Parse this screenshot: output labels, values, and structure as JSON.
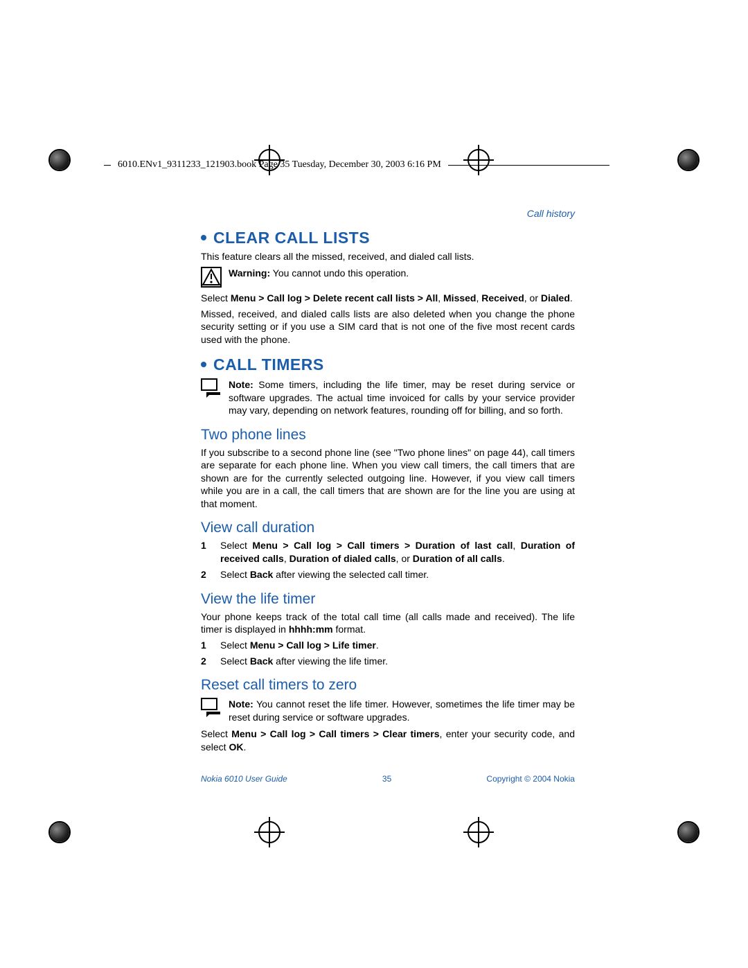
{
  "header": {
    "book_line": "6010.ENv1_9311233_121903.book  Page 35  Tuesday, December 30, 2003  6:16 PM"
  },
  "section_header": "Call history",
  "s1": {
    "title": "CLEAR CALL LISTS",
    "intro": "This feature clears all the missed, received, and dialed call lists.",
    "warning_label": "Warning:",
    "warning_text": " You cannot undo this operation.",
    "select_pre": "Select ",
    "select_bold": "Menu > Call log > Delete recent call lists > All",
    "select_mid1": ", ",
    "select_b2": "Missed",
    "select_mid2": ", ",
    "select_b3": "Received",
    "select_mid3": ", or ",
    "select_b4": "Dialed",
    "select_end": ".",
    "tail": "Missed, received, and dialed calls lists are also deleted when you change the phone security setting or if you use a SIM card that is not one of the five most recent cards used with the phone."
  },
  "s2": {
    "title": "CALL TIMERS",
    "note_label": "Note:",
    "note_text": "  Some timers, including the life timer, may be reset during service or software upgrades. The actual time invoiced for calls by your service provider may vary, depending on network features, rounding off for billing, and so forth."
  },
  "s3": {
    "title": "Two phone lines",
    "body": "If you subscribe to a second phone line (see \"Two phone lines\" on page 44), call timers are separate for each phone line. When you view call timers, the call timers that are shown are for the currently selected outgoing line. However, if you view call timers while you are in a call, the call timers that are shown are for the line you are using at that moment."
  },
  "s4": {
    "title": "View call duration",
    "step1_pre": "Select ",
    "step1_b1": "Menu > Call log > Call timers > Duration of last call",
    "step1_m1": ", ",
    "step1_b2": "Duration of received calls",
    "step1_m2": ", ",
    "step1_b3": "Duration of dialed calls",
    "step1_m3": ", or ",
    "step1_b4": "Duration of all calls",
    "step1_end": ".",
    "step2_pre": "Select ",
    "step2_b1": "Back",
    "step2_end": " after viewing the selected call timer."
  },
  "s5": {
    "title": "View the life timer",
    "intro_pre": "Your phone keeps track of the total call time (all calls made and received). The life timer is displayed in ",
    "intro_b": "hhhh:mm",
    "intro_end": " format.",
    "step1_pre": "Select ",
    "step1_b": "Menu > Call log > Life timer",
    "step1_end": ".",
    "step2_pre": "Select ",
    "step2_b": "Back",
    "step2_end": " after viewing the life timer."
  },
  "s6": {
    "title": "Reset call timers to zero",
    "note_label": "Note:",
    "note_text": "  You cannot reset the life timer. However, sometimes the life timer may be reset during service or software upgrades.",
    "body_pre": "Select ",
    "body_b1": "Menu > Call log > Call timers > Clear timers",
    "body_mid": ", enter your security code, and select ",
    "body_b2": "OK",
    "body_end": "."
  },
  "footer": {
    "left": "Nokia 6010 User Guide",
    "mid": "35",
    "right": "Copyright © 2004 Nokia"
  }
}
